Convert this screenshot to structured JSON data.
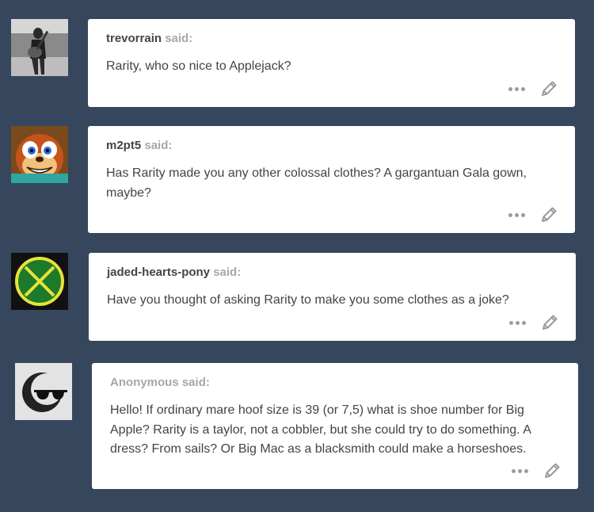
{
  "said_label": "said:",
  "posts": [
    {
      "username": "trevorrain",
      "question": "Rarity, who so nice to Applejack?",
      "avatar_icon": "guitar-player-photo-icon"
    },
    {
      "username": "m2pt5",
      "question": "Has Rarity made you any other colossal clothes? A gargantuan Gala gown, maybe?",
      "avatar_icon": "cartoon-squirrel-icon"
    },
    {
      "username": "jaded-hearts-pony",
      "question": "Have you thought of asking Rarity to make you some clothes as a joke?",
      "avatar_icon": "green-x-circle-icon"
    },
    {
      "username": "Anonymous",
      "question": "Hello! If ordinary mare hoof size is 39 (or 7,5) what is shoe number for Big Apple? Rarity is a taylor, not a cobbler, but she could try to do something. A dress? From sails? Or Big Mac as a blacksmith could make a horseshoes.",
      "avatar_icon": "anonymous-sunglasses-icon"
    }
  ],
  "colors": {
    "background": "#36465d",
    "card": "#ffffff",
    "text": "#444444",
    "muted": "#a7a7a7"
  }
}
